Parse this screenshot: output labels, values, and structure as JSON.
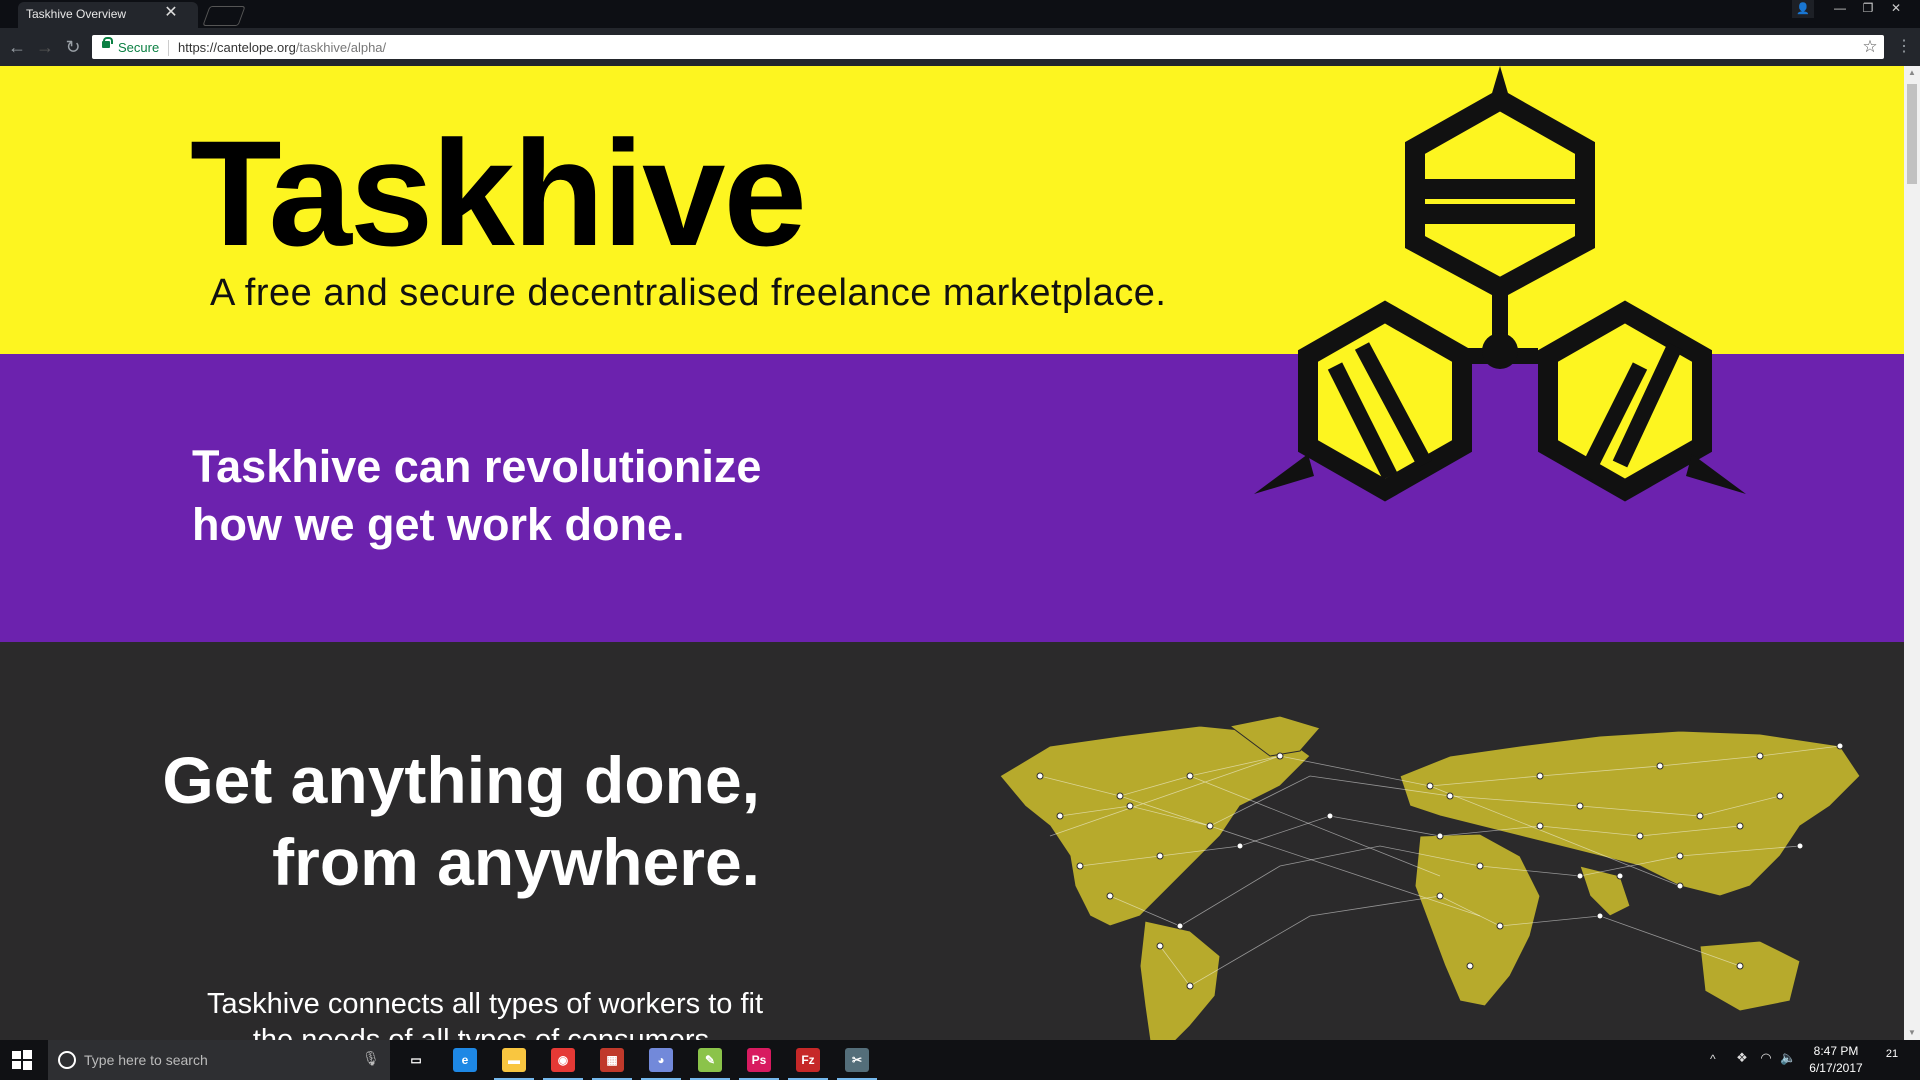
{
  "browser": {
    "tab_title": "Taskhive Overview",
    "tab_close": "✕",
    "secure_label": "Secure",
    "url_host": "https://cantelope.org",
    "url_path": "/taskhive/alpha/"
  },
  "page": {
    "hero_title": "Taskhive",
    "hero_tagline": "A free and secure decentralised freelance marketplace.",
    "purple_heading": "Taskhive can revolutionize how we get work done.",
    "dark_heading_line1": "Get anything done,",
    "dark_heading_line2": "from anywhere.",
    "dark_body_line1": "Taskhive connects all types of workers to fit",
    "dark_body_line2": "the needs of all types of consumers."
  },
  "colors": {
    "hero_bg": "#fdf520",
    "purple_bg": "#6c22ae",
    "dark_bg": "#2b2a2b",
    "map_land": "#b7aa2c",
    "secure_green": "#0b8043"
  },
  "taskbar": {
    "search_placeholder": "Type here to search",
    "apps": [
      {
        "name": "task-view-icon",
        "glyph": "▭",
        "color": "#101114"
      },
      {
        "name": "edge-icon",
        "glyph": "e",
        "color": "#1e88e5"
      },
      {
        "name": "file-explorer-icon",
        "glyph": "▬",
        "color": "#f9c640"
      },
      {
        "name": "chrome-icon",
        "glyph": "◉",
        "color": "#e53935"
      },
      {
        "name": "app-icon",
        "glyph": "▦",
        "color": "#c0392b"
      },
      {
        "name": "discord-icon",
        "glyph": "◕",
        "color": "#7289da"
      },
      {
        "name": "notepad-plus-icon",
        "glyph": "✎",
        "color": "#8bc34a"
      },
      {
        "name": "photoshop-icon",
        "glyph": "Ps",
        "color": "#d81b60"
      },
      {
        "name": "filezilla-icon",
        "glyph": "Fz",
        "color": "#c62828"
      },
      {
        "name": "snipping-tool-icon",
        "glyph": "✂",
        "color": "#546e7a"
      }
    ],
    "clock_time": "8:47 PM",
    "clock_date": "6/17/2017",
    "notification_count": "21"
  }
}
